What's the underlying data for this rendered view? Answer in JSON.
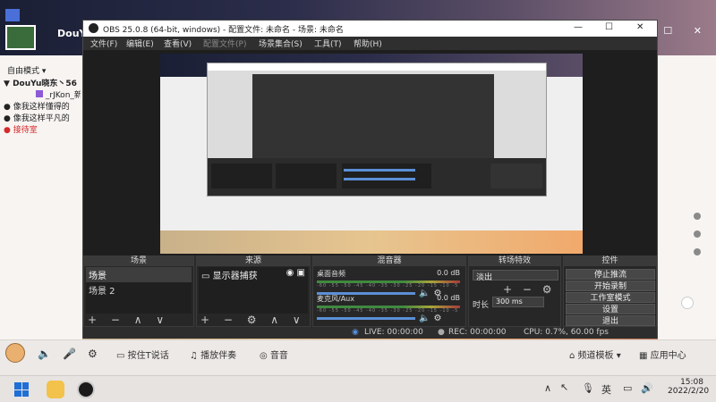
{
  "douyu": {
    "app_name": "DouY",
    "mode_label": "自由模式",
    "channels": [
      {
        "label": "DouYu晓东丶56",
        "color": "#000000"
      },
      {
        "label": "_rJKon_新",
        "color": "#222222"
      },
      {
        "label": "像我这样懂得的",
        "color": "#222222"
      },
      {
        "label": "像我这样平凡的",
        "color": "#222222"
      },
      {
        "label": "接待室",
        "color": "#d42a2a"
      }
    ],
    "bottom_bar": {
      "ptt_label": "按住T说话",
      "music_label": "播放伴奏",
      "sound_effects_label": "音音",
      "channel_template_label": "频道模板",
      "app_center_label": "应用中心"
    }
  },
  "obs": {
    "title": "OBS 25.0.8 (64-bit, windows) - 配置文件: 未命名 - 场景: 未命名",
    "menu": [
      "文件(F)",
      "编辑(E)",
      "查看(V)",
      "配置文件(P)",
      "场景集合(S)",
      "工具(T)",
      "帮助(H)"
    ],
    "window_controls": [
      "—",
      "☐",
      "✕"
    ],
    "docks": {
      "scenes": {
        "title": "场景",
        "items": [
          "场景",
          "场景 2"
        ]
      },
      "sources": {
        "title": "来源",
        "items": [
          "显示器捕获"
        ]
      },
      "mixer": {
        "title": "混音器",
        "tracks": [
          {
            "name": "桌面音频",
            "level": "0.0 dB"
          },
          {
            "name": "麦克风/Aux",
            "level": "0.0 dB"
          }
        ],
        "scale": "-60 -55 -50 -45 -40 -35 -30 -25 -20 -15 -10 -5 0"
      },
      "transitions": {
        "title": "转场特效",
        "selected": "淡出",
        "duration_label": "时长",
        "duration_value": "300 ms"
      },
      "controls": {
        "title": "控件",
        "buttons": [
          "停止推流",
          "开始录制",
          "工作室模式",
          "设置",
          "退出"
        ]
      }
    },
    "status": {
      "live": "LIVE: 00:00:00",
      "rec": "REC: 00:00:00",
      "cpu": "CPU: 0.7%, 60.00 fps"
    }
  },
  "taskbar": {
    "time": "15:08",
    "date": "2022/2/20",
    "ime": "英"
  },
  "colors": {
    "obs_bg": "#2b2b2b",
    "accent_blue": "#5b8fd6",
    "alert_red": "#d42a2a"
  }
}
